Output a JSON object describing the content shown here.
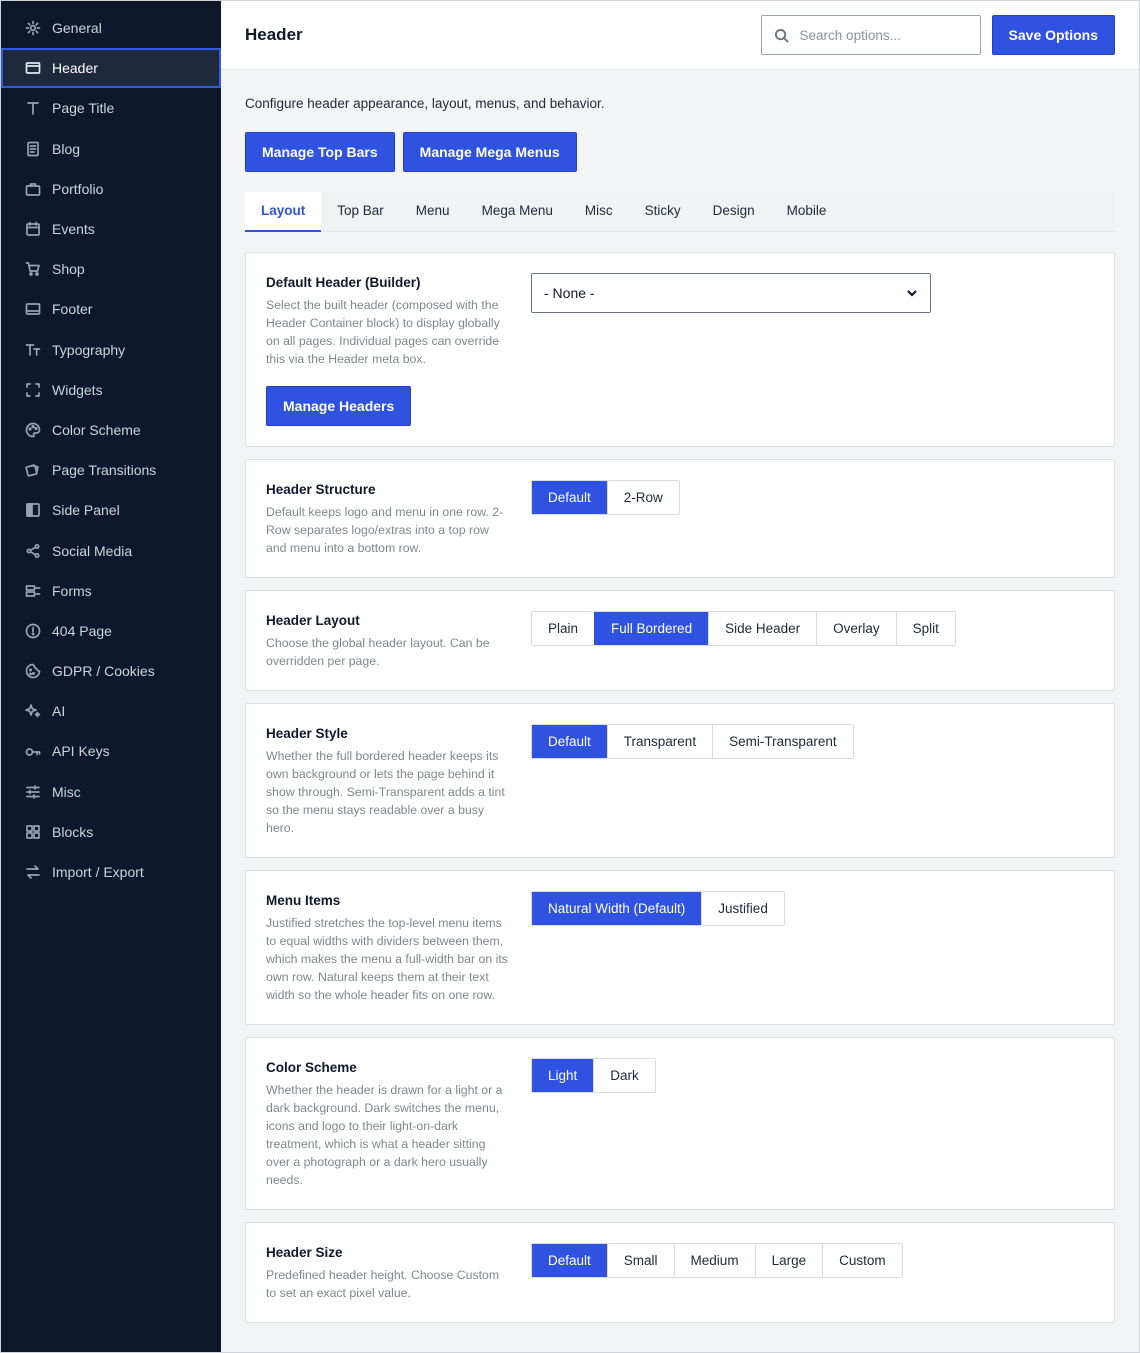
{
  "sidebar": {
    "items": [
      {
        "label": "General",
        "icon": "gear-icon",
        "active": false
      },
      {
        "label": "Header",
        "icon": "window-icon",
        "active": true
      },
      {
        "label": "Page Title",
        "icon": "title-t-icon",
        "active": false
      },
      {
        "label": "Blog",
        "icon": "document-icon",
        "active": false
      },
      {
        "label": "Portfolio",
        "icon": "briefcase-icon",
        "active": false
      },
      {
        "label": "Events",
        "icon": "calendar-icon",
        "active": false
      },
      {
        "label": "Shop",
        "icon": "cart-icon",
        "active": false
      },
      {
        "label": "Footer",
        "icon": "footer-icon",
        "active": false
      },
      {
        "label": "Typography",
        "icon": "typography-icon",
        "active": false
      },
      {
        "label": "Widgets",
        "icon": "widgets-icon",
        "active": false
      },
      {
        "label": "Color Scheme",
        "icon": "palette-icon",
        "active": false
      },
      {
        "label": "Page Transitions",
        "icon": "transition-icon",
        "active": false
      },
      {
        "label": "Side Panel",
        "icon": "side-panel-icon",
        "active": false
      },
      {
        "label": "Social Media",
        "icon": "share-icon",
        "active": false
      },
      {
        "label": "Forms",
        "icon": "forms-icon",
        "active": false
      },
      {
        "label": "404 Page",
        "icon": "alert-icon",
        "active": false
      },
      {
        "label": "GDPR / Cookies",
        "icon": "cookie-icon",
        "active": false
      },
      {
        "label": "AI",
        "icon": "sparkle-icon",
        "active": false
      },
      {
        "label": "API Keys",
        "icon": "key-icon",
        "active": false
      },
      {
        "label": "Misc",
        "icon": "sliders-icon",
        "active": false
      },
      {
        "label": "Blocks",
        "icon": "grid-icon",
        "active": false
      },
      {
        "label": "Import / Export",
        "icon": "import-export-icon",
        "active": false
      }
    ]
  },
  "header": {
    "title": "Header",
    "search_placeholder": "Search options...",
    "save_label": "Save Options"
  },
  "main": {
    "intro": "Configure header appearance, layout, menus, and behavior.",
    "actions": [
      "Manage Top Bars",
      "Manage Mega Menus"
    ],
    "tabs": [
      {
        "label": "Layout",
        "active": true
      },
      {
        "label": "Top Bar",
        "active": false
      },
      {
        "label": "Menu",
        "active": false
      },
      {
        "label": "Mega Menu",
        "active": false
      },
      {
        "label": "Misc",
        "active": false
      },
      {
        "label": "Sticky",
        "active": false
      },
      {
        "label": "Design",
        "active": false
      },
      {
        "label": "Mobile",
        "active": false
      }
    ],
    "default_header": {
      "label": "Default Header (Builder)",
      "desc": "Select the built header (composed with the Header Container block) to display globally on all pages. Individual pages can override this via the Header meta box.",
      "select_value": "- None -",
      "button": "Manage Headers"
    },
    "settings": [
      {
        "key": "header-structure",
        "label": "Header Structure",
        "desc": "Default keeps logo and menu in one row. 2-Row separates logo/extras into a top row and menu into a bottom row.",
        "options": [
          "Default",
          "2-Row"
        ],
        "selected": 0
      },
      {
        "key": "header-layout",
        "label": "Header Layout",
        "desc": "Choose the global header layout. Can be overridden per page.",
        "options": [
          "Plain",
          "Full Bordered",
          "Side Header",
          "Overlay",
          "Split"
        ],
        "selected": 1
      },
      {
        "key": "header-style",
        "label": "Header Style",
        "desc": "Whether the full bordered header keeps its own background or lets the page behind it show through. Semi-Transparent adds a tint so the menu stays readable over a busy hero.",
        "options": [
          "Default",
          "Transparent",
          "Semi-Transparent"
        ],
        "selected": 0
      },
      {
        "key": "menu-items",
        "label": "Menu Items",
        "desc": "Justified stretches the top-level menu items to equal widths with dividers between them, which makes the menu a full-width bar on its own row. Natural keeps them at their text width so the whole header fits on one row.",
        "options": [
          "Natural Width (Default)",
          "Justified"
        ],
        "selected": 0
      },
      {
        "key": "color-scheme",
        "label": "Color Scheme",
        "desc": "Whether the header is drawn for a light or a dark background. Dark switches the menu, icons and logo to their light-on-dark treatment, which is what a header sitting over a photograph or a dark hero usually needs.",
        "options": [
          "Light",
          "Dark"
        ],
        "selected": 0
      },
      {
        "key": "header-size",
        "label": "Header Size",
        "desc": "Predefined header height. Choose Custom to set an exact pixel value.",
        "options": [
          "Default",
          "Small",
          "Medium",
          "Large",
          "Custom"
        ],
        "selected": 0
      }
    ]
  },
  "colors": {
    "accent": "#2f52e0",
    "sidebar_bg": "#0f172a",
    "page_bg": "#f3f4f6"
  }
}
